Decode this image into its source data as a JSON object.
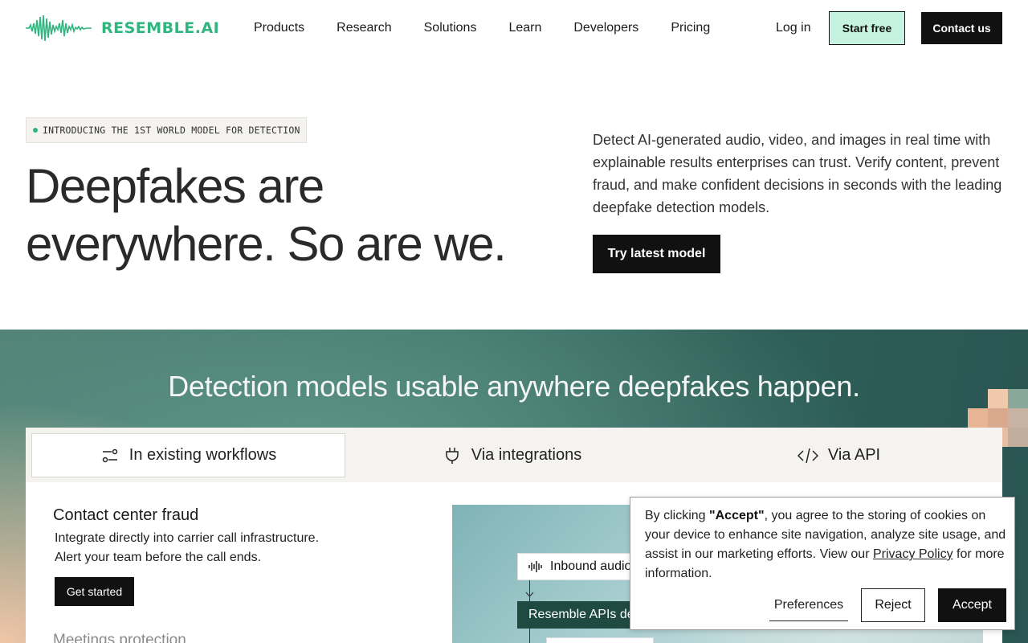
{
  "nav": {
    "logo_text": "RESEMBLE.AI",
    "links": [
      "Products",
      "Research",
      "Solutions",
      "Learn",
      "Developers",
      "Pricing"
    ],
    "login": "Log in",
    "start_free": "Start free",
    "contact_us": "Contact us"
  },
  "hero": {
    "badge": "INTRODUCING THE 1ST WORLD MODEL FOR DETECTION",
    "title_line1": "Deepfakes are",
    "title_line2": "everywhere. So are we.",
    "description": "Detect AI-generated audio, video, and images in real time with explainable results enterprises can trust. Verify content, prevent fraud, and make confident decisions in seconds with the leading deepfake detection models.",
    "cta": "Try latest model"
  },
  "section": {
    "title": "Detection models usable anywhere deepfakes happen.",
    "tabs": [
      {
        "label": "In existing workflows",
        "icon": "sliders-icon"
      },
      {
        "label": "Via integrations",
        "icon": "plug-icon"
      },
      {
        "label": "Via API",
        "icon": "code-icon"
      }
    ],
    "card": {
      "title": "Contact center fraud",
      "desc_line1": "Integrate directly into carrier call infrastructure.",
      "desc_line2": "Alert your team before the call ends.",
      "cta": "Get started",
      "next_title": "Meetings protection"
    },
    "visual": {
      "inbound_label": "Inbound audio",
      "apis_label": "Resemble APIs detect"
    }
  },
  "cookie": {
    "text_prefix": "By clicking ",
    "text_accept_bold": "\"Accept\"",
    "text_middle": ", you agree to the storing of cookies on your device to enhance site navigation, analyze site usage, and assist in our marketing efforts. View our ",
    "privacy_link": "Privacy Policy",
    "text_suffix": " for more information.",
    "preferences": "Preferences",
    "reject": "Reject",
    "accept": "Accept"
  },
  "colors": {
    "brand_green": "#2fb67f",
    "start_free_bg": "#c6f2e0",
    "dark": "#111111"
  }
}
